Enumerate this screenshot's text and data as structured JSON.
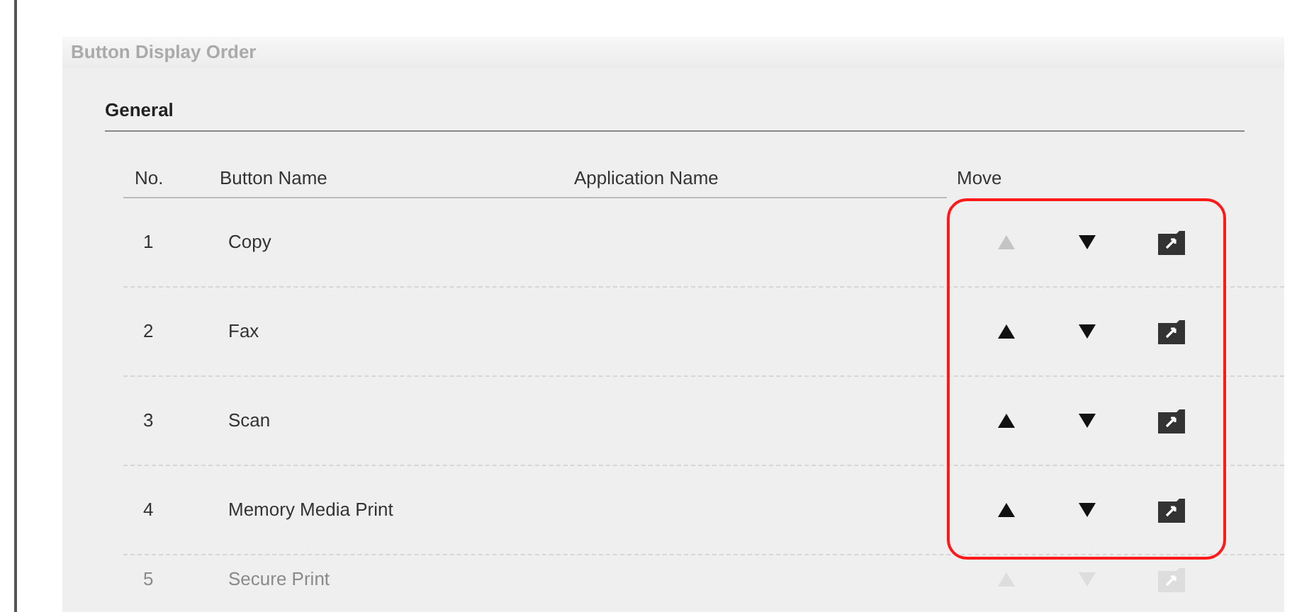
{
  "panel": {
    "title": "Button Display Order"
  },
  "section": {
    "title": "General"
  },
  "table": {
    "columns": [
      "No.",
      "Button Name",
      "Application Name",
      "Move"
    ],
    "rows": [
      {
        "no": "1",
        "button_name": "Copy",
        "up_enabled": false,
        "down_enabled": true,
        "faded": false
      },
      {
        "no": "2",
        "button_name": "Fax",
        "up_enabled": true,
        "down_enabled": true,
        "faded": false
      },
      {
        "no": "3",
        "button_name": "Scan",
        "up_enabled": true,
        "down_enabled": true,
        "faded": false
      },
      {
        "no": "4",
        "button_name": "Memory Media Print",
        "up_enabled": true,
        "down_enabled": true,
        "faded": false
      },
      {
        "no": "5",
        "button_name": "Secure Print",
        "up_enabled": true,
        "down_enabled": true,
        "faded": true
      }
    ]
  },
  "highlight": {
    "on": true
  }
}
